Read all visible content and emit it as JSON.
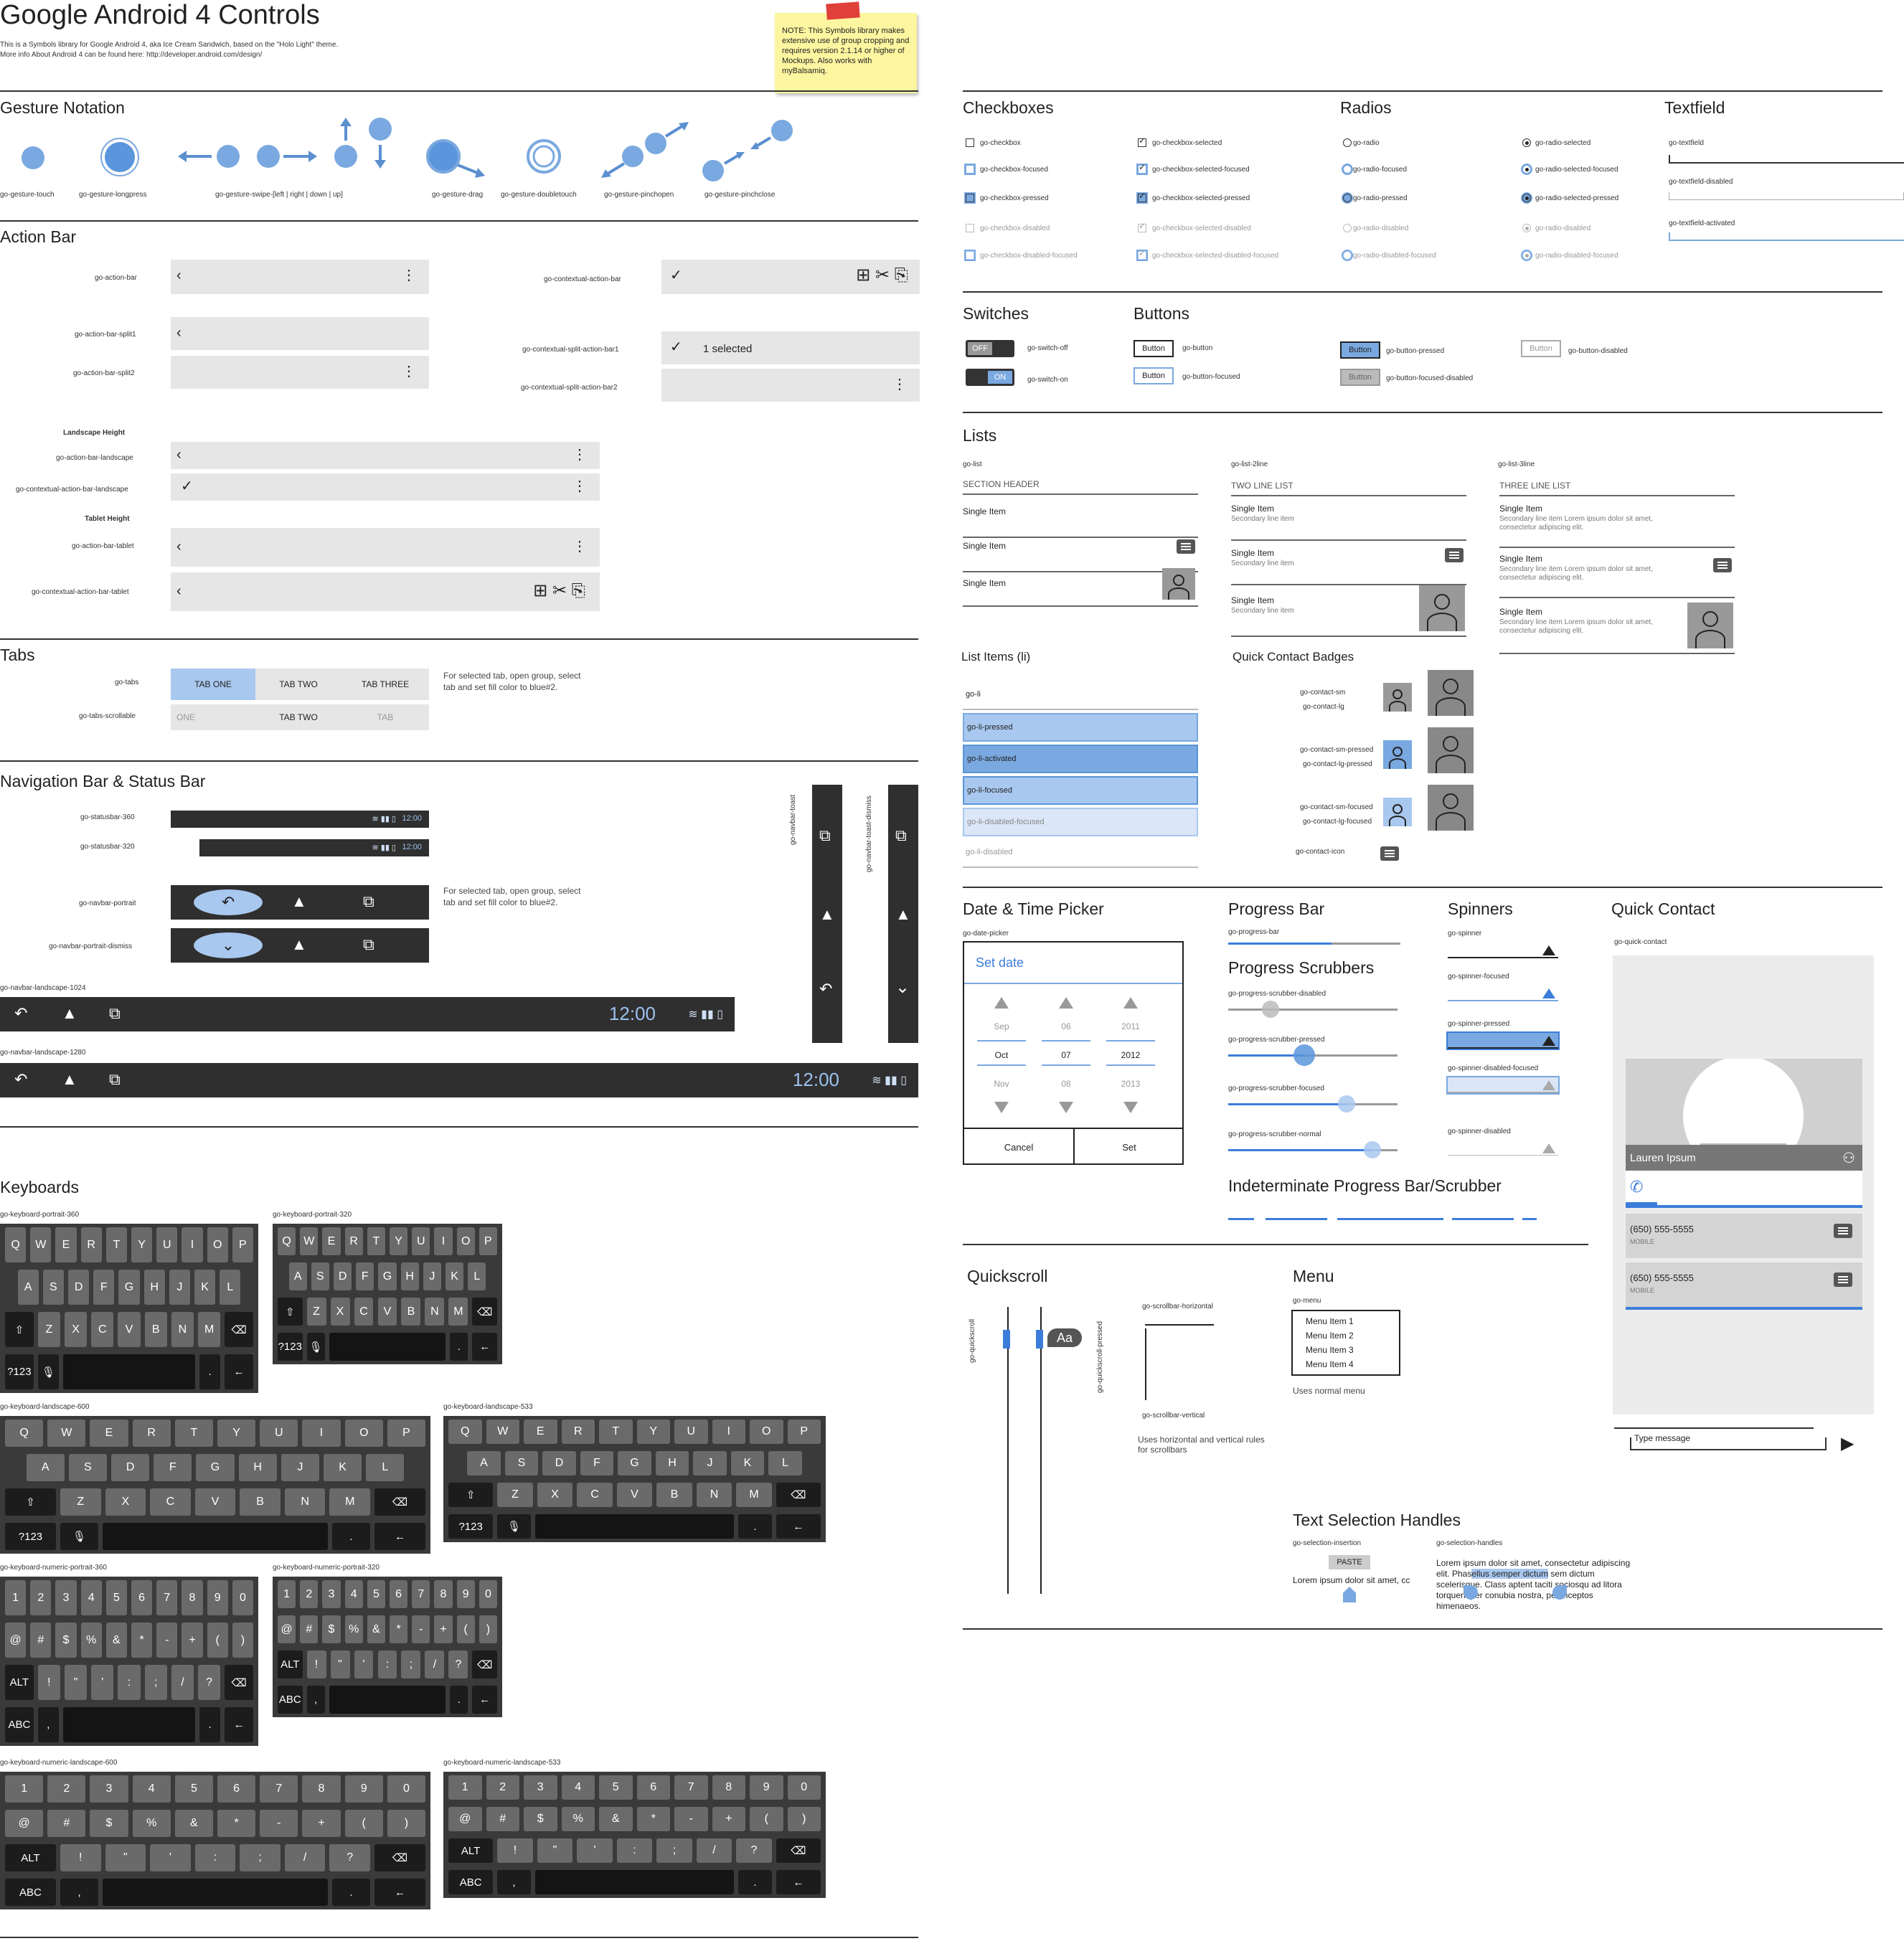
{
  "header": {
    "title": "Google Android 4 Controls",
    "desc1": "This is a Symbols library for Google Android 4, aka Ice Cream Sandwich, based on the \"Holo Light\" theme.",
    "desc2": "More info About Android 4 can be found here: http://developer.android.com/design/",
    "note": "NOTE: This Symbols library makes extensive use of group cropping and requires version 2.1.14 or higher of Mockups. Also works with myBalsamiq."
  },
  "colors": {
    "accent": "#7aa8e0",
    "accent_blue": "#3c7dd9",
    "dark": "#2f2f2f",
    "bar": "#e6e6e6",
    "note": "#fdf6a0"
  },
  "sections": {
    "gesture": "Gesture Notation",
    "actionbar": "Action Bar",
    "tabs": "Tabs",
    "nav": "Navigation Bar & Status Bar",
    "keyboards": "Keyboards",
    "checkboxes": "Checkboxes",
    "radios": "Radios",
    "textfield": "Textfield",
    "switches": "Switches",
    "buttons": "Buttons",
    "lists": "Lists",
    "listitems": "List Items (li)",
    "qcb": "Quick Contact Badges",
    "datetime": "Date & Time Picker",
    "progress": "Progress Bar",
    "scrubbers": "Progress Scrubbers",
    "spinners": "Spinners",
    "quickcontact": "Quick Contact",
    "indeterminate": "Indeterminate Progress Bar/Scrubber",
    "quickscroll": "Quickscroll",
    "menu": "Menu",
    "textsel": "Text Selection Handles"
  },
  "gestures": [
    "go-gesture-touch",
    "go-gesture-longpress",
    "go-gesture-swipe-[left | right | down | up]",
    "go-gesture-drag",
    "go-gesture-doubletouch",
    "go-gesture-pinchopen",
    "go-gesture-pinchclose"
  ],
  "actionbar": {
    "labels": [
      "go-action-bar",
      "go-action-bar-split1",
      "go-action-bar-split2",
      "Landscape Height",
      "go-action-bar-landscape",
      "go-contextual-action-bar-landscape",
      "Tablet Height",
      "go-action-bar-tablet",
      "go-contextual-action-bar-tablet",
      "go-contextual-action-bar",
      "go-contextual-split-action-bar1",
      "go-contextual-split-action-bar2"
    ],
    "selected": "1 selected"
  },
  "tabs": {
    "labels": [
      "go-tabs",
      "go-tabs-scrollable"
    ],
    "row1": [
      "TAB ONE",
      "TAB TWO",
      "TAB THREE"
    ],
    "row2": [
      "ONE",
      "TAB TWO",
      "TAB"
    ],
    "note": "For selected tab, open group, select tab and set fill color to blue#2."
  },
  "nav": {
    "labels": [
      "go-statusbar-360",
      "go-statusbar-320",
      "go-navbar-portrait",
      "go-navbar-portrait-dismiss",
      "go-navbar-landscape-1024",
      "go-navbar-landscape-1280",
      "go-navbar-toast",
      "go-navbar-toast-dismiss"
    ],
    "time": "12:00",
    "note": "For selected tab, open group, select tab and set fill color to blue#2."
  },
  "keyboards": {
    "labels": [
      "go-keyboard-portrait-360",
      "go-keyboard-portrait-320",
      "go-keyboard-landscape-600",
      "go-keyboard-landscape-533",
      "go-keyboard-numeric-portrait-360",
      "go-keyboard-numeric-portrait-320",
      "go-keyboard-numeric-landscape-600",
      "go-keyboard-numeric-landscape-533"
    ],
    "alpha": [
      [
        "Q",
        "W",
        "E",
        "R",
        "T",
        "Y",
        "U",
        "I",
        "O",
        "P"
      ],
      [
        "A",
        "S",
        "D",
        "F",
        "G",
        "H",
        "J",
        "K",
        "L"
      ],
      [
        "⇧",
        "Z",
        "X",
        "C",
        "V",
        "B",
        "N",
        "M",
        "⌫"
      ],
      [
        "?123",
        "🎙",
        "",
        ".",
        "←"
      ]
    ],
    "numeric": [
      [
        "1",
        "2",
        "3",
        "4",
        "5",
        "6",
        "7",
        "8",
        "9",
        "0"
      ],
      [
        "@",
        "#",
        "$",
        "%",
        "&",
        "*",
        "-",
        "+",
        "(",
        ")"
      ],
      [
        "ALT",
        "!",
        "\"",
        "'",
        ":",
        ";",
        "/",
        "?",
        "⌫"
      ],
      [
        "ABC",
        ",",
        "",
        ".",
        "←"
      ]
    ]
  },
  "checkboxes": [
    "go-checkbox",
    "go-checkbox-focused",
    "go-checkbox-pressed",
    "go-checkbox-disabled",
    "go-checkbox-disabled-focused",
    "go-checkbox-selected",
    "go-checkbox-selected-focused",
    "go-checkbox-selected-pressed",
    "go-checkbox-selected-disabled",
    "go-checkbox-selected-disabled-focused"
  ],
  "radios": [
    "go-radio",
    "go-radio-focused",
    "go-radio-pressed",
    "go-radio-disabled",
    "go-radio-disabled-focused",
    "go-radio-selected",
    "go-radio-selected-focused",
    "go-radio-selected-pressed",
    "go-radio-disabled",
    "go-radio-disabled-focused"
  ],
  "textfields": [
    "go-textfield",
    "go-textfield-disabled",
    "go-textfield-activated"
  ],
  "switches": {
    "labels": [
      "go-switch-off",
      "go-switch-on"
    ],
    "off": "OFF",
    "on": "ON"
  },
  "buttons": {
    "text": "Button",
    "labels": [
      "go-button",
      "go-button-focused",
      "go-button-pressed",
      "go-button-focused-disabled",
      "go-button-disabled"
    ]
  },
  "lists": {
    "labels": [
      "go-list",
      "go-list-2line",
      "go-list-3line"
    ],
    "headers": [
      "SECTION HEADER",
      "TWO LINE LIST",
      "THREE LINE LIST"
    ],
    "item": "Single Item",
    "secondary": "Secondary line item",
    "secondary3": "Secondary line item Lorem ipsum dolor sit amet,",
    "secondary3b": "consectetur adipiscing elit."
  },
  "listitems": [
    "go-li",
    "go-li-pressed",
    "go-li-activated",
    "go-li-focused",
    "go-li-disabled-focused",
    "go-li-disabled"
  ],
  "qcb": [
    "go-contact-sm",
    "go-contact-lg",
    "go-contact-sm-pressed",
    "go-contact-lg-pressed",
    "go-contact-sm-focused",
    "go-contact-lg-focused",
    "go-contact-icon"
  ],
  "datepicker": {
    "label": "go-date-picker",
    "title": "Set date",
    "col1": [
      "Sep",
      "Oct",
      "Nov"
    ],
    "col2": [
      "06",
      "07",
      "08"
    ],
    "col3": [
      "2011",
      "2012",
      "2013"
    ],
    "cancel": "Cancel",
    "set": "Set"
  },
  "progress": {
    "label": "go-progress-bar",
    "value": 0.6
  },
  "scrubbers": [
    {
      "label": "go-progress-scrubber-disabled",
      "value": 0.25
    },
    {
      "label": "go-progress-scrubber-pressed",
      "value": 0.45
    },
    {
      "label": "go-progress-scrubber-focused",
      "value": 0.7
    },
    {
      "label": "go-progress-scrubber-normal",
      "value": 0.85
    }
  ],
  "spinners": [
    "go-spinner",
    "go-spinner-focused",
    "go-spinner-pressed",
    "go-spinner-disabled-focused",
    "go-spinner-disabled"
  ],
  "quickcontact": {
    "label": "go-quick-contact",
    "name": "Lauren Ipsum",
    "phone": "(650) 555-5555",
    "type": "MOBILE",
    "message": "Type message"
  },
  "quickscroll": {
    "labels": [
      "go-quickscroll",
      "go-quickscroll-pressed",
      "go-scrollbar-horizontal",
      "go-scrollbar-vertical"
    ],
    "aa": "Aa",
    "note": "Uses horizontal and vertical rules for scrollbars"
  },
  "menu": {
    "label": "go-menu",
    "items": [
      "Menu Item 1",
      "Menu Item 2",
      "Menu Item 3",
      "Menu Item 4"
    ],
    "note": "Uses normal menu"
  },
  "textsel": {
    "labels": [
      "go-selection-insertion",
      "go-selection-handles"
    ],
    "paste": "PASTE",
    "ins_text": "Lorem ipsum dolor sit amet, cc",
    "line1": "Lorem ipsum dolor sit amet, consectetur adipiscing",
    "line2a": "elit. Phas",
    "line2b": "ellus semper dictum",
    "line2c": " sem dictum",
    "line3": "scelerisque. Class aptent taciti sociosqu ad litora",
    "line4": "torquent per conubia nostra, per inceptos",
    "line5": "himenaeos."
  }
}
